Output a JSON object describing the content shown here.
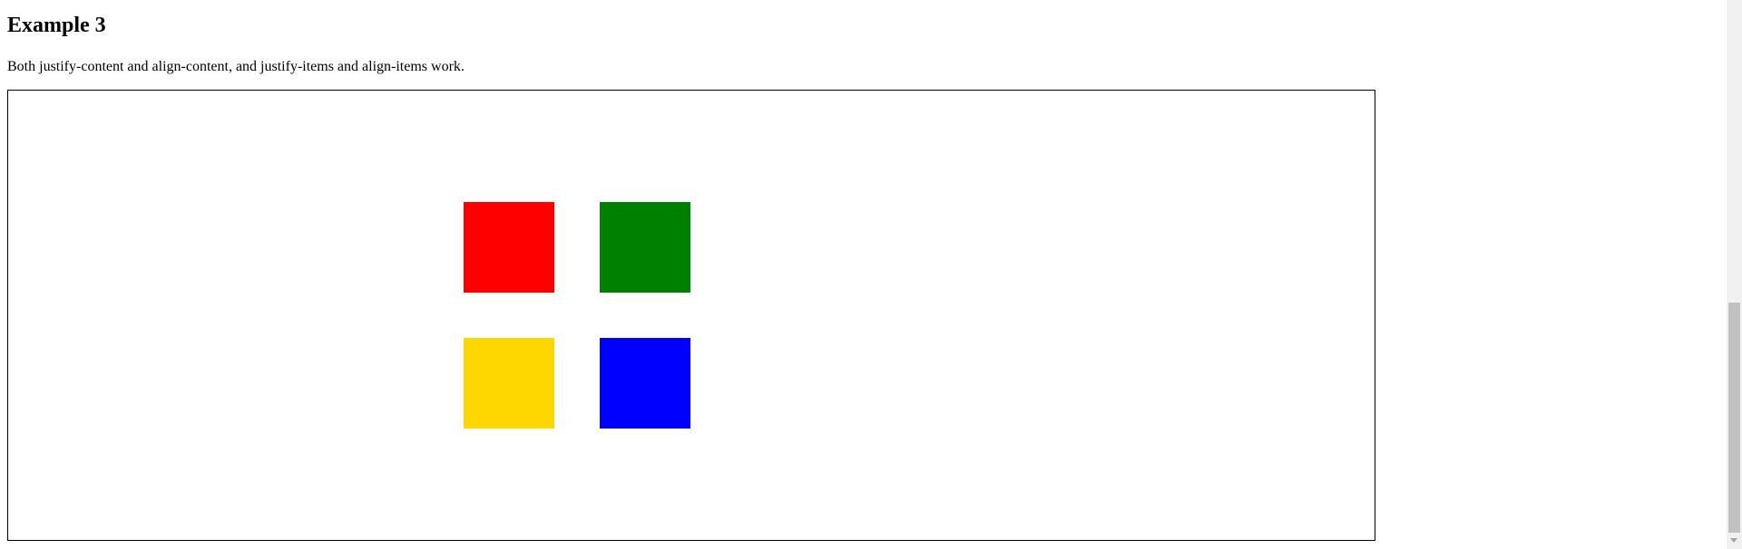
{
  "heading": "Example 3",
  "description": "Both justify-content and align-content, and justify-items and align-items work.",
  "grid": {
    "items": [
      {
        "name": "red",
        "color": "#ff0000"
      },
      {
        "name": "green",
        "color": "#008000"
      },
      {
        "name": "yellow",
        "color": "#ffd700"
      },
      {
        "name": "blue",
        "color": "#0000ff"
      }
    ]
  },
  "scrollbar": {
    "icon": "chevron-down-icon"
  }
}
